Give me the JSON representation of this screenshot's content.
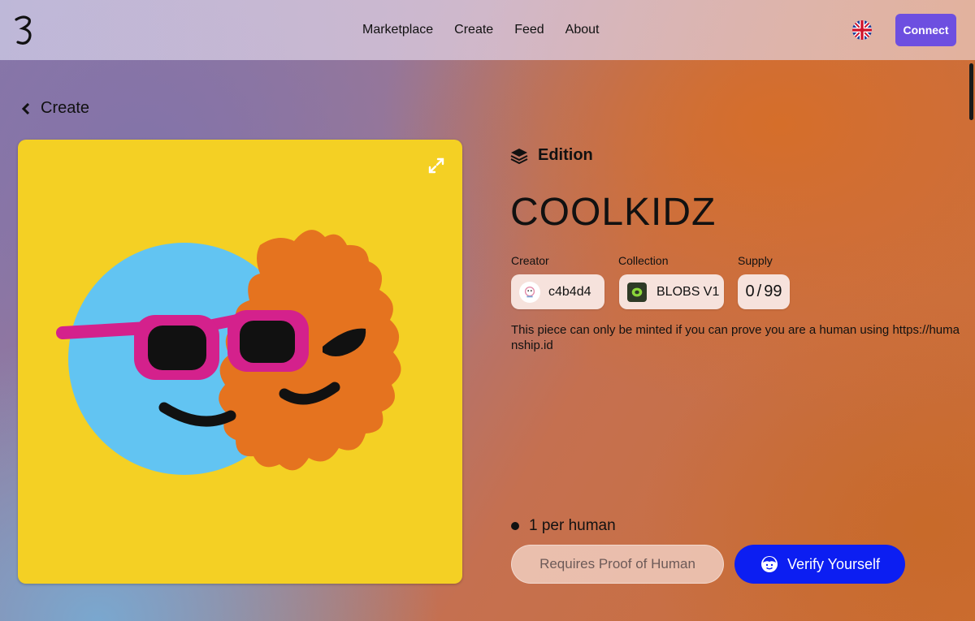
{
  "header": {
    "nav": [
      "Marketplace",
      "Create",
      "Feed",
      "About"
    ],
    "connect_label": "Connect",
    "language_icon": "uk-flag-icon"
  },
  "back_label": "Create",
  "artwork": {
    "expand_icon": "expand-icon"
  },
  "details": {
    "type_label": "Edition",
    "title": "COOLKIDZ",
    "creator_label": "Creator",
    "creator_name": "c4b4d4",
    "collection_label": "Collection",
    "collection_name": "BLOBS V1",
    "supply_label": "Supply",
    "supply_minted": "0",
    "supply_total": "99",
    "description": "This piece can only be minted if you can prove you are a human using https://humanship.id",
    "limit_text": "1 per human",
    "requires_label": "Requires Proof of Human",
    "verify_label": "Verify Yourself"
  },
  "colors": {
    "accent": "#6d4fe0",
    "verify": "#0c1ef2",
    "artwork_bg": "#f4d024"
  }
}
